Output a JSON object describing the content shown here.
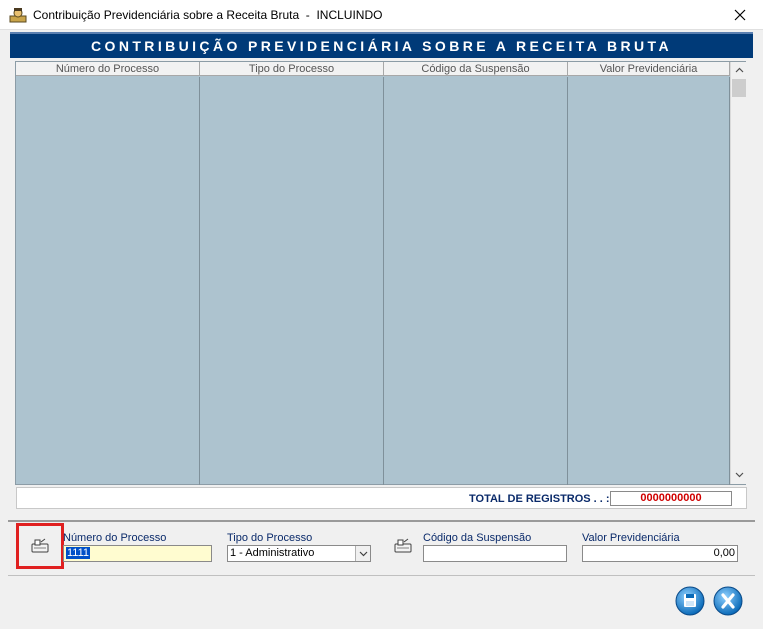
{
  "window": {
    "title": "Contribuição Previdenciária sobre a Receita Bruta  -  INCLUINDO",
    "app_icon": "user-badge-icon",
    "close_icon": "close-icon"
  },
  "banner": {
    "title": "CONTRIBUIÇÃO PREVIDENCIÁRIA SOBRE A RECEITA BRUTA"
  },
  "grid": {
    "columns": [
      "Número do Processo",
      "Tipo do Processo",
      "Código da Suspensão",
      "Valor Previdenciária"
    ],
    "rows": []
  },
  "totals": {
    "label": "TOTAL DE REGISTROS . . :",
    "count": "0000000000"
  },
  "form": {
    "numero_label": "Número do Processo",
    "numero_value": "1111",
    "tipo_label": "Tipo do Processo",
    "tipo_value": "1 - Administrativo",
    "codigo_label": "Código da Suspensão",
    "codigo_value": "",
    "valor_label": "Valor Previdenciária",
    "valor_value": "0,00",
    "search_icon_left": "binoculars-search-icon",
    "search_icon_right": "binoculars-search-icon"
  },
  "actions": {
    "save_icon": "save-icon",
    "cancel_icon": "cancel-x-icon"
  },
  "colors": {
    "banner": "#003a78",
    "grid_bg": "#adc3cf",
    "total_count": "#d00000",
    "label_text": "#0a2a6a"
  }
}
